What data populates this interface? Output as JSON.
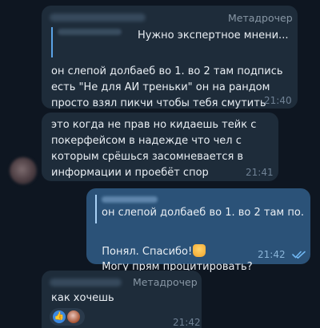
{
  "chat": {
    "messages": [
      {
        "sender_label": "Метадрочер",
        "reply_preview": "Нужно экспертное мнени...",
        "text": "он слепой долбаеб во 1. во 2 там подпись есть \"Не для АИ треньки\" он на рандом просто взял пикчи чтобы тебя смутить",
        "time": "21:40"
      },
      {
        "text": "это когда не прав но кидаешь тейк с покерфейсом в надежде что чел с которым срёшься засомневается в информации и проебёт спор",
        "time": "21:41"
      },
      {
        "reply_preview": "он слепой долбаеб во 1. во 2 там по...",
        "line1": "Понял. Спасибо!",
        "line2": "Могу прям процитировать?",
        "time": "21:42",
        "status_icon": "double-check-icon"
      },
      {
        "sender_label": "Метадрочер",
        "text": "как хочешь",
        "time": "21:42",
        "reactions": [
          "thumbs-up-icon",
          "avatar"
        ]
      }
    ]
  },
  "colors": {
    "background": "#0e1621",
    "incoming_bubble": "#1e2c3a",
    "outgoing_bubble": "#2b5278",
    "reply_accent": "#5aa3e6",
    "time_text": "#6f8194"
  }
}
